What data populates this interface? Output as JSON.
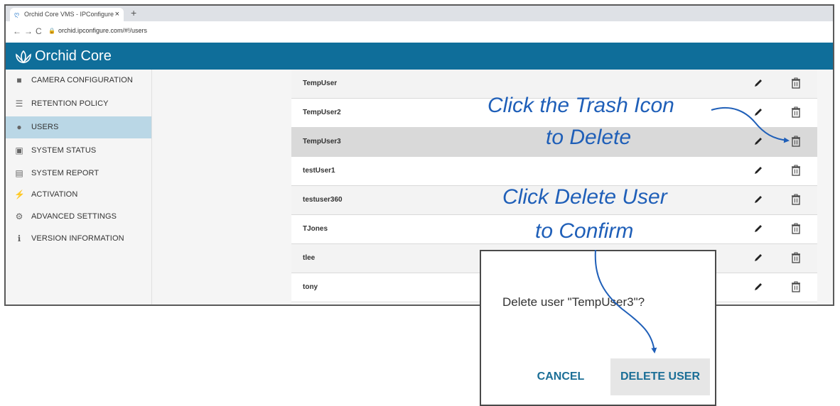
{
  "browser": {
    "tab_title": "Orchid Core VMS - IPConfigure",
    "url": "orchid.ipconfigure.com/#!/users",
    "new_tab": "+",
    "close_tab": "×"
  },
  "app": {
    "title": "Orchid Core",
    "brand_color": "#0f6e9a"
  },
  "sidebar": {
    "items": [
      {
        "label": "CAMERA CONFIGURATION",
        "icon": "video-camera-icon"
      },
      {
        "label": "RETENTION POLICY",
        "icon": "database-icon"
      },
      {
        "label": "USERS",
        "icon": "user-icon",
        "active": true
      },
      {
        "label": "SYSTEM STATUS",
        "icon": "status-icon"
      },
      {
        "label": "SYSTEM REPORT",
        "icon": "report-icon"
      },
      {
        "label": "ACTIVATION",
        "icon": "plug-icon"
      },
      {
        "label": "ADVANCED SETTINGS",
        "icon": "gears-icon"
      },
      {
        "label": "VERSION INFORMATION",
        "icon": "info-icon"
      }
    ]
  },
  "users": [
    {
      "name": "TempUser"
    },
    {
      "name": "TempUser2"
    },
    {
      "name": "TempUser3",
      "selected": true
    },
    {
      "name": "testUser1"
    },
    {
      "name": "testuser360"
    },
    {
      "name": "TJones"
    },
    {
      "name": "tlee"
    },
    {
      "name": "tony"
    }
  ],
  "annotations": {
    "trash_line1": "Click the Trash Icon",
    "trash_line2": "to Delete",
    "confirm_line1": "Click Delete User",
    "confirm_line2": "to Confirm",
    "color": "#1f5fb8"
  },
  "dialog": {
    "message": "Delete user \"TempUser3\"?",
    "cancel_label": "CANCEL",
    "delete_label": "DELETE USER"
  }
}
